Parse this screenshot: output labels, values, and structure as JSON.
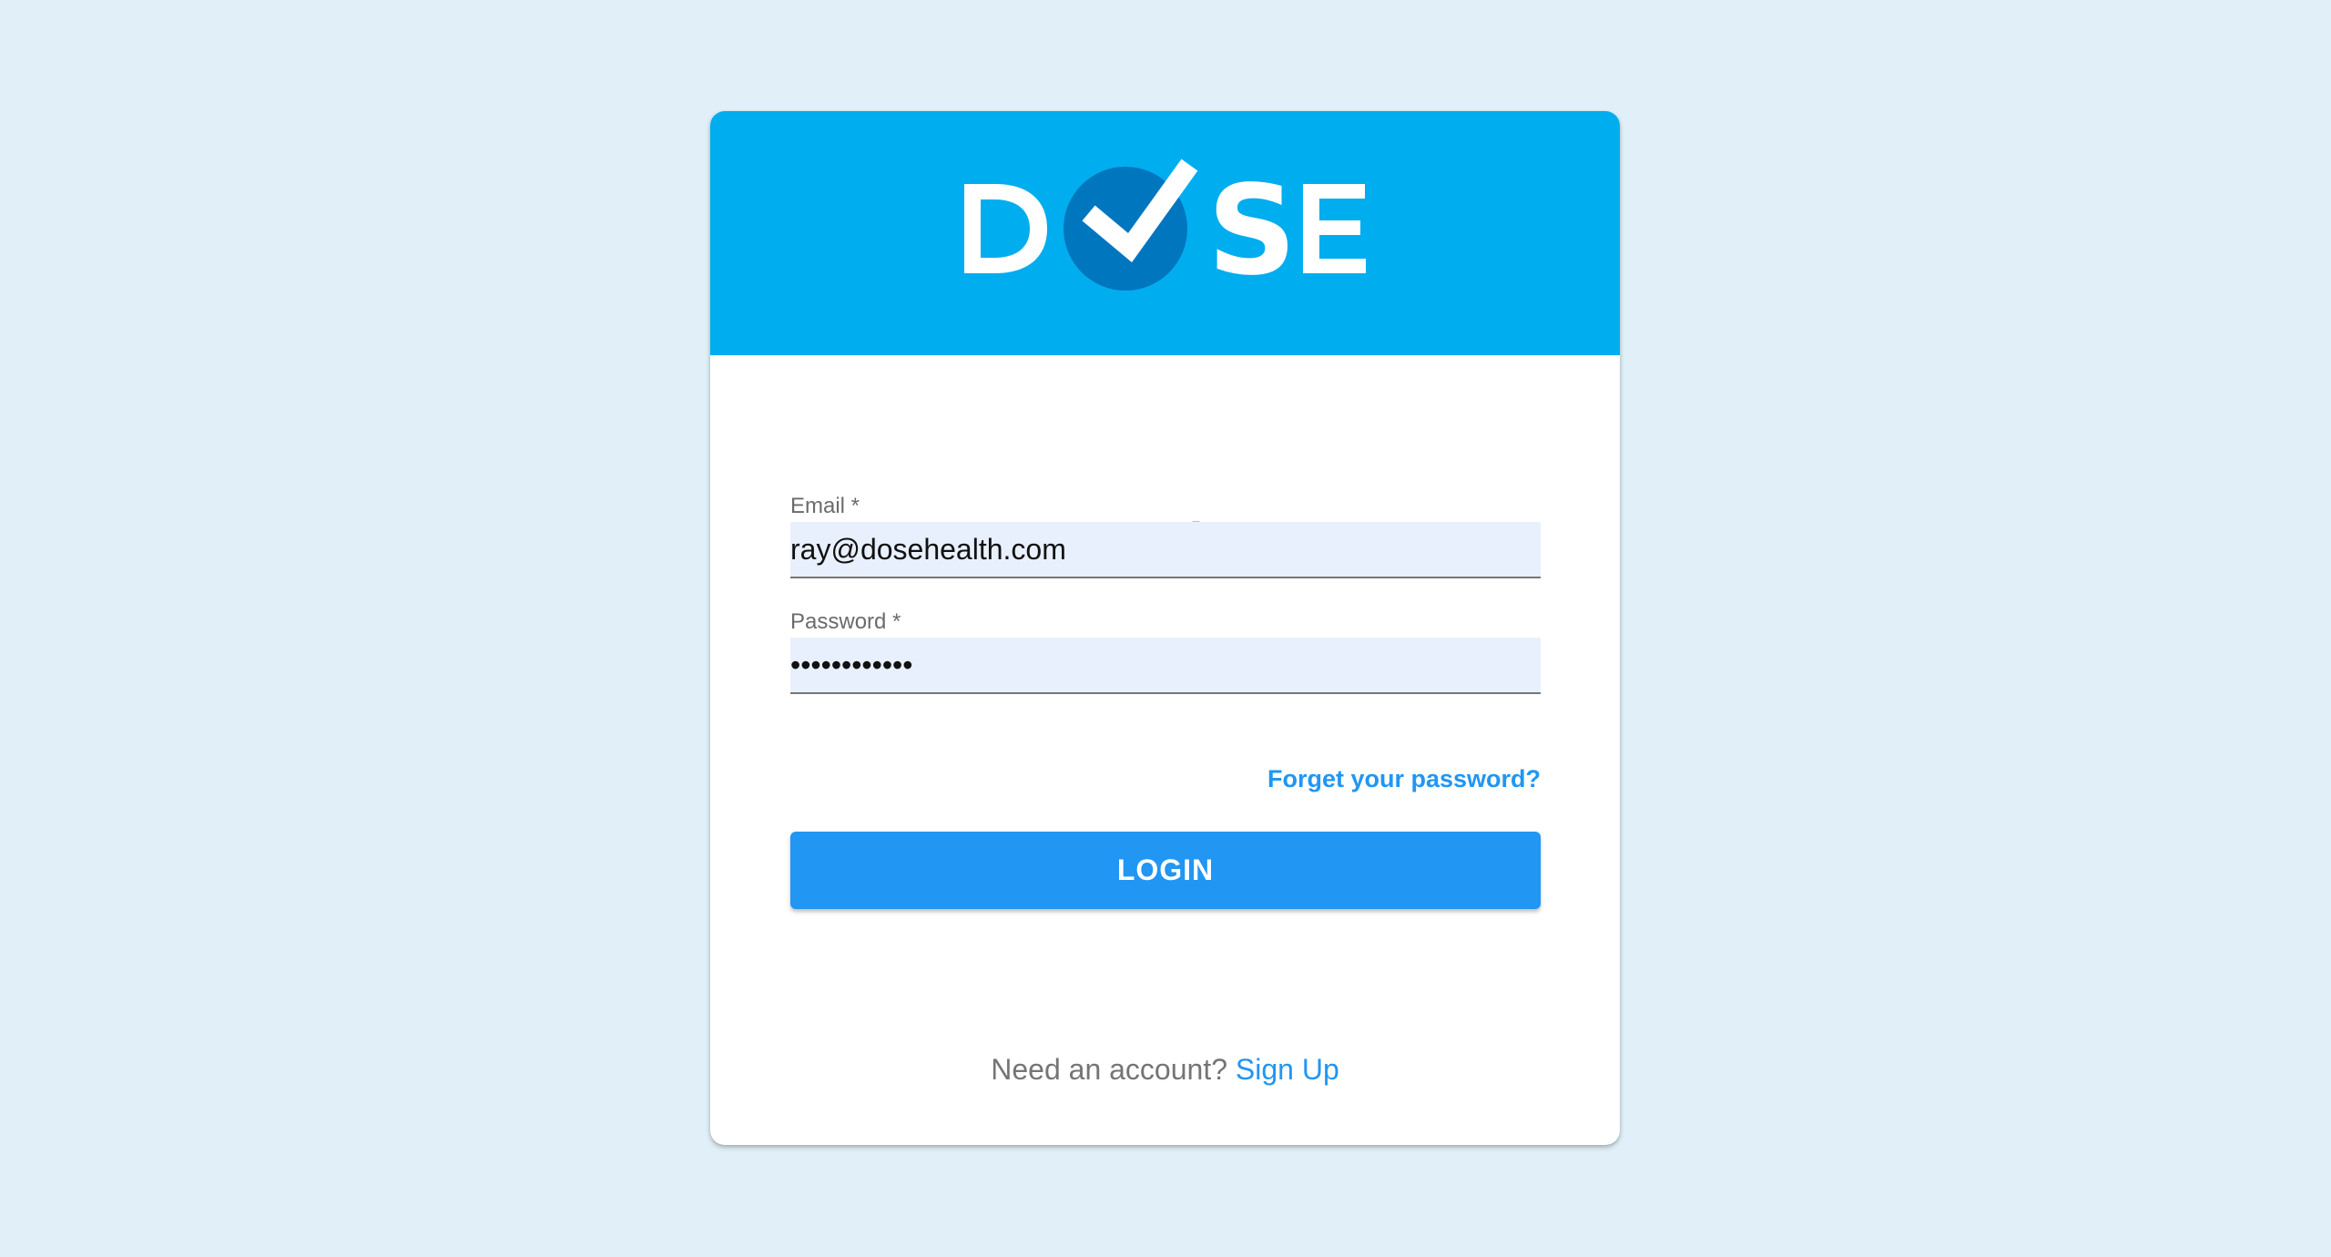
{
  "brand": {
    "logo_text": "DOSE",
    "colors": {
      "header": "#00adef",
      "logo_circle": "#0076bf",
      "accent": "#2196f3",
      "page_background": "#e1f0f8"
    }
  },
  "login": {
    "title": "Login",
    "email": {
      "label": "Email *",
      "value": "ray@dosehealth.com"
    },
    "password": {
      "label": "Password *",
      "value": "••••••••••••"
    },
    "forgot_password_label": "Forget your password?",
    "submit_label": "LOGIN"
  },
  "signup": {
    "prompt": "Need an account?",
    "link_label": "Sign Up"
  }
}
